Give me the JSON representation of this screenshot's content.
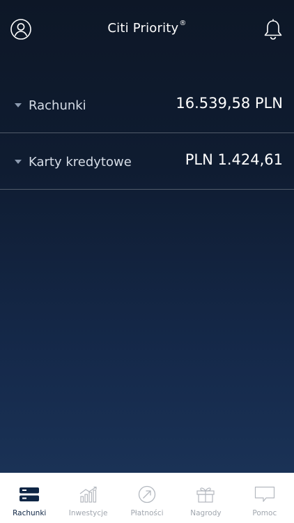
{
  "header": {
    "title": "Citi Priority",
    "title_mark": "®",
    "profile_icon": "profile-icon",
    "notification_icon": "bell-icon"
  },
  "summary": {
    "rows": [
      {
        "label": "Rachunki",
        "amount": "16.539,58 PLN"
      },
      {
        "label": "Karty kredytowe",
        "amount": "PLN 1.424,61"
      }
    ]
  },
  "tabbar": {
    "tabs": [
      {
        "label": "Rachunki",
        "icon": "accounts-icon",
        "active": true
      },
      {
        "label": "Inwestycje",
        "icon": "investments-icon",
        "active": false
      },
      {
        "label": "Płatności",
        "icon": "payments-icon",
        "active": false
      },
      {
        "label": "Nagrody",
        "icon": "gift-icon",
        "active": false
      },
      {
        "label": "Pomoc",
        "icon": "chat-icon",
        "active": false
      }
    ]
  },
  "colors": {
    "background_top": "#0d1727",
    "background_bottom": "#1a3256",
    "tab_active": "#0e2544",
    "tab_inactive": "#a0a6ae"
  }
}
